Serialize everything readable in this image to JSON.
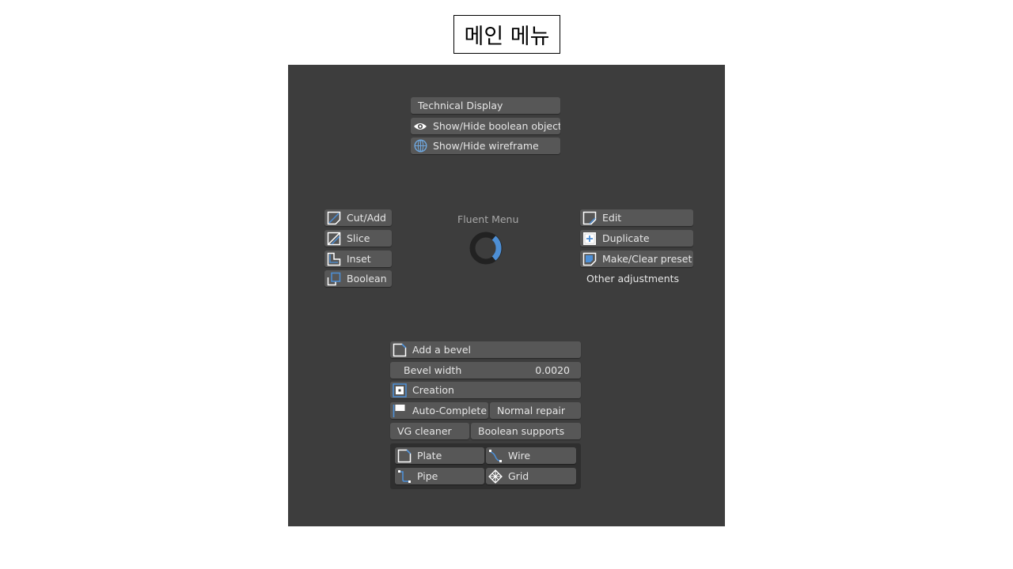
{
  "header": {
    "title": "메인 메뉴"
  },
  "menu": {
    "title": "Fluent Menu",
    "top": [
      {
        "label": "Technical Display",
        "icon": "none"
      },
      {
        "label": "Show/Hide boolean object",
        "icon": "eye-icon"
      },
      {
        "label": "Show/Hide wireframe",
        "icon": "globe-icon"
      }
    ],
    "left": [
      {
        "label": "Cut/Add",
        "icon": "cut-add-icon"
      },
      {
        "label": "Slice",
        "icon": "slice-icon"
      },
      {
        "label": "Inset",
        "icon": "inset-icon"
      },
      {
        "label": "Boolean",
        "icon": "boolean-icon"
      }
    ],
    "right": [
      {
        "label": "Edit",
        "icon": "edit-icon"
      },
      {
        "label": "Duplicate",
        "icon": "duplicate-icon"
      },
      {
        "label": "Make/Clear preset",
        "icon": "preset-icon"
      }
    ],
    "other_adjustments": "Other adjustments",
    "bottom": {
      "add_bevel": "Add a bevel",
      "bevel_width_label": "Bevel width",
      "bevel_width_value": "0.0020",
      "creation": "Creation",
      "auto_complete": "Auto-Complete",
      "normal_repair": "Normal repair",
      "vg_cleaner": "VG cleaner",
      "boolean_supports": "Boolean supports",
      "plate": "Plate",
      "wire": "Wire",
      "pipe": "Pipe",
      "grid": "Grid"
    }
  },
  "colors": {
    "accent": "#4d8fd6",
    "panel": "#3d3d3d",
    "button": "#575757"
  }
}
